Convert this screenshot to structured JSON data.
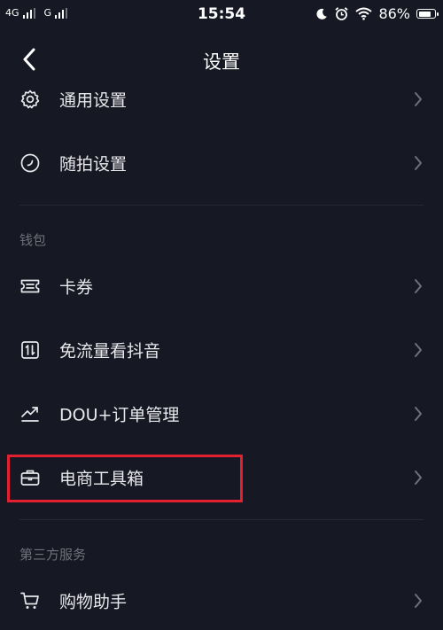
{
  "status_bar": {
    "net1": "4G",
    "net2": "G",
    "time": "15:54",
    "battery": "86%",
    "battery_level": 0.86
  },
  "nav": {
    "title": "设置"
  },
  "items": [
    {
      "label": "通用设置",
      "icon": "gear-icon"
    },
    {
      "label": "随拍设置",
      "icon": "clock-circle-icon"
    }
  ],
  "wallet": {
    "title": "钱包",
    "items": [
      {
        "label": "卡券",
        "icon": "ticket-icon"
      },
      {
        "label": "免流量看抖音",
        "icon": "data-card-icon"
      },
      {
        "label": "DOU+订单管理",
        "icon": "trend-arrow-icon"
      },
      {
        "label": "电商工具箱",
        "icon": "briefcase-icon",
        "highlighted": true
      }
    ]
  },
  "third_party": {
    "title": "第三方服务",
    "items": [
      {
        "label": "购物助手",
        "icon": "shopping-cart-icon"
      }
    ]
  },
  "colors": {
    "background": "#161823",
    "text": "#e8e8ec",
    "muted": "#6f7079",
    "highlight": "#e22030"
  }
}
